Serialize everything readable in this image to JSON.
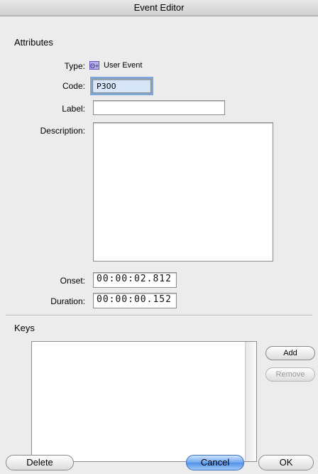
{
  "window": {
    "title": "Event Editor"
  },
  "attributes": {
    "section_title": "Attributes",
    "type_label": "Type:",
    "type_icon_glyph": "Θ+",
    "type_value": "User Event",
    "code_label": "Code:",
    "code_value": "P300",
    "label_label": "Label:",
    "label_value": "",
    "description_label": "Description:",
    "description_value": "",
    "onset_label": "Onset:",
    "onset_value": "00:00:02.812",
    "duration_label": "Duration:",
    "duration_value": "00:00:00.152"
  },
  "keys": {
    "section_title": "Keys",
    "add_label": "Add",
    "remove_label": "Remove",
    "items": []
  },
  "footer": {
    "delete_label": "Delete",
    "cancel_label": "Cancel",
    "ok_label": "OK"
  },
  "colors": {
    "focus_ring": "#7ea7d8",
    "default_button": "#4f8fe6",
    "type_icon": "#b7b1f0"
  }
}
